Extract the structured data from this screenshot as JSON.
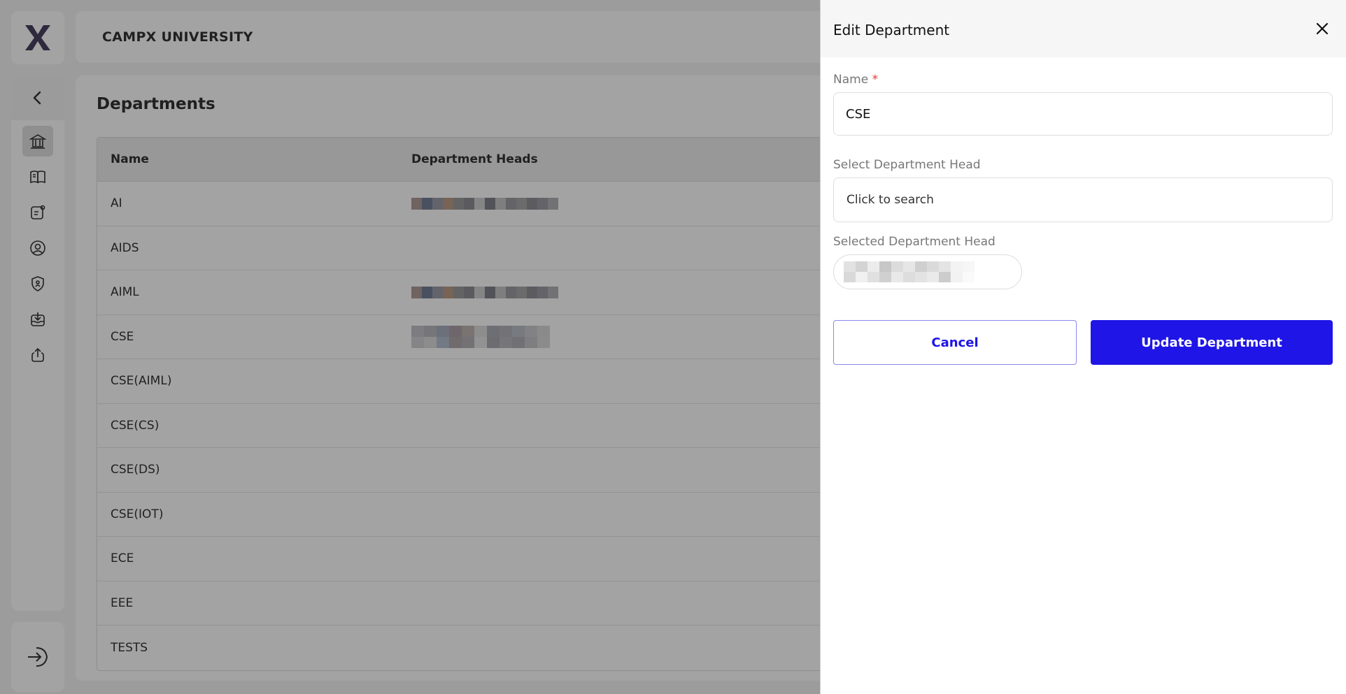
{
  "app": {
    "logo_icon": "campx-x-logo",
    "org_name": "CAMPX UNIVERSITY",
    "brand_color": "#1f15e6"
  },
  "sidebar": {
    "items": [
      {
        "icon": "bank-icon",
        "active": true
      },
      {
        "icon": "book-icon",
        "active": false
      },
      {
        "icon": "notice-icon",
        "active": false
      },
      {
        "icon": "user-circle-icon",
        "active": false
      },
      {
        "icon": "shield-icon",
        "active": false
      },
      {
        "icon": "download-tray-icon",
        "active": false
      },
      {
        "icon": "upload-icon",
        "active": false
      }
    ],
    "logout_icon": "logout-icon"
  },
  "main": {
    "title": "Departments",
    "table": {
      "columns": [
        "Name",
        "Department Heads"
      ],
      "rows": [
        {
          "name": "AI",
          "head": "redacted"
        },
        {
          "name": "AIDS",
          "head": ""
        },
        {
          "name": "AIML",
          "head": "redacted"
        },
        {
          "name": "CSE",
          "head": "redacted"
        },
        {
          "name": "CSE(AIML)",
          "head": ""
        },
        {
          "name": "CSE(CS)",
          "head": ""
        },
        {
          "name": "CSE(DS)",
          "head": ""
        },
        {
          "name": "CSE(IOT)",
          "head": ""
        },
        {
          "name": "ECE",
          "head": ""
        },
        {
          "name": "EEE",
          "head": ""
        },
        {
          "name": "TESTS",
          "head": ""
        }
      ]
    }
  },
  "drawer": {
    "title": "Edit Department",
    "name_label": "Name",
    "required_mark": "*",
    "name_value": "CSE",
    "select_head_label": "Select Department Head",
    "search_placeholder": "Click to search",
    "selected_head_label": "Selected Department Head",
    "cancel_label": "Cancel",
    "update_label": "Update Department"
  }
}
